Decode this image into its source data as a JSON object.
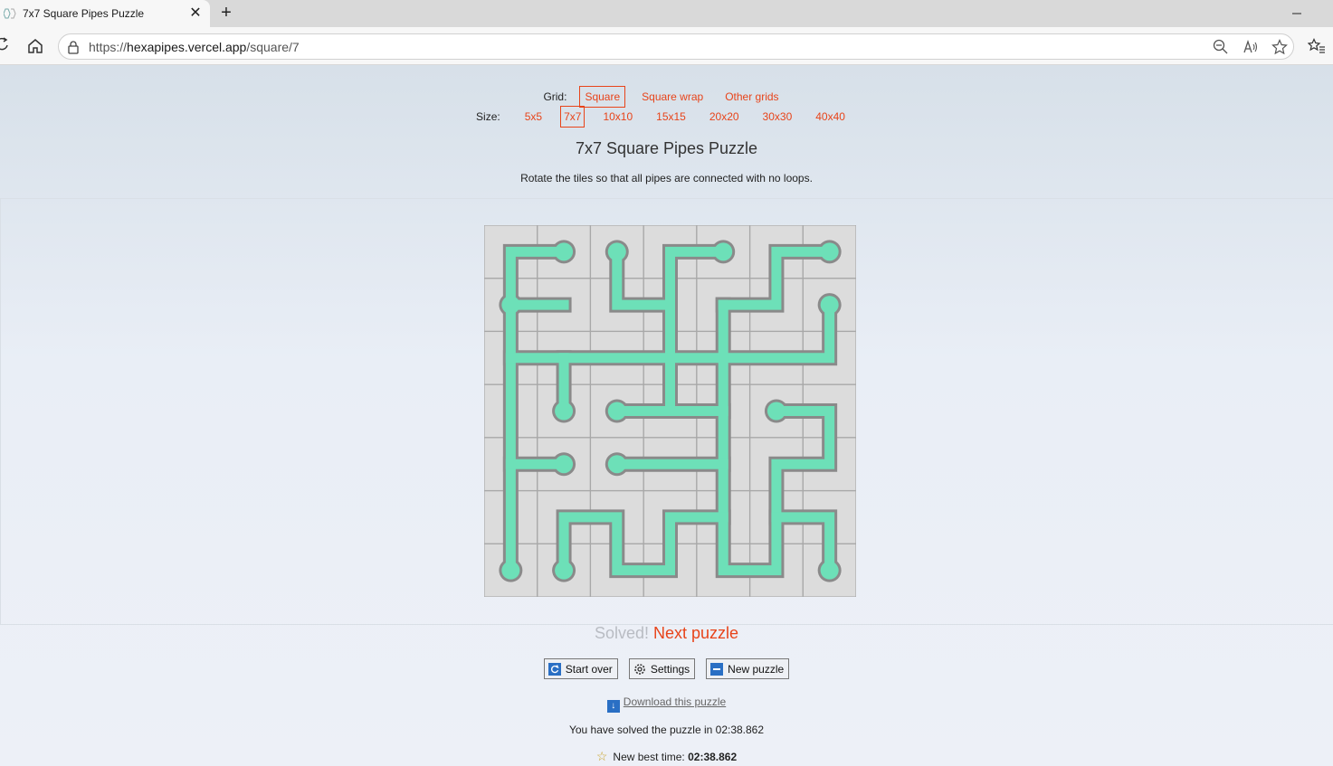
{
  "browser": {
    "tab_title": "7x7 Square Pipes Puzzle",
    "tab_close": "✕",
    "new_tab": "+",
    "url_prefix": "https://",
    "url_host": "hexapipes.vercel.app",
    "url_path": "/square/7"
  },
  "grid_selector": {
    "label": "Grid:",
    "options": [
      "Square",
      "Square wrap",
      "Other grids"
    ],
    "selected": "Square"
  },
  "size_selector": {
    "label": "Size:",
    "options": [
      "5x5",
      "7x7",
      "10x10",
      "15x15",
      "20x20",
      "30x30",
      "40x40"
    ],
    "selected": "7x7"
  },
  "puzzle": {
    "title": "7x7 Square Pipes Puzzle",
    "instructions": "Rotate the tiles so that all pipes are connected with no loops.",
    "rows": 7,
    "cols": 7,
    "pipe_color": "#6de0b8",
    "outline_color": "#8a8a8a",
    "tile_color": "#dcdcdc"
  },
  "status": {
    "solved": "Solved!",
    "next": "Next puzzle"
  },
  "buttons": {
    "start_over": "Start over",
    "settings": "Settings",
    "new_puzzle": "New puzzle"
  },
  "download": "Download this puzzle",
  "solve_time_text": "You have solved the puzzle in 02:38.862",
  "best_time_label": "New best time:",
  "best_time_value": "02:38.862"
}
